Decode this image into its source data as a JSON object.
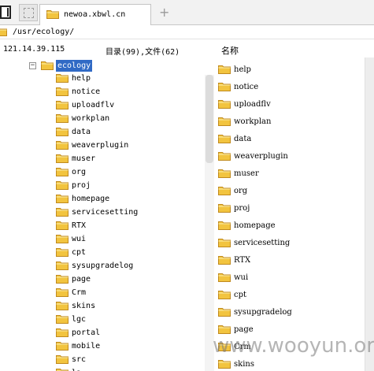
{
  "tab": {
    "title": "newoa.xbwl.cn",
    "new_tab_symbol": "+"
  },
  "address": {
    "path": "/usr/ecology/"
  },
  "info": {
    "ip": "121.14.39.115",
    "count": "目录(99),文件(62)",
    "name_header": "名称"
  },
  "tree": {
    "root": {
      "label": "ecology",
      "expanded_symbol": "−"
    },
    "children": [
      "help",
      "notice",
      "uploadflv",
      "workplan",
      "data",
      "weaverplugin",
      "muser",
      "org",
      "proj",
      "homepage",
      "servicesetting",
      "RTX",
      "wui",
      "cpt",
      "sysupgradelog",
      "page",
      "Crm",
      "skins",
      "lgc",
      "portal",
      "mobile",
      "src",
      "la"
    ]
  },
  "list": {
    "items": [
      "help",
      "notice",
      "uploadflv",
      "workplan",
      "data",
      "weaverplugin",
      "muser",
      "org",
      "proj",
      "homepage",
      "servicesetting",
      "RTX",
      "wui",
      "cpt",
      "sysupgradelog",
      "page",
      "Crm",
      "skins"
    ]
  },
  "watermark": "www.wooyun.org",
  "colors": {
    "folder": "#f2c43f",
    "folder_border": "#c08a1e",
    "selection": "#316ac5"
  }
}
